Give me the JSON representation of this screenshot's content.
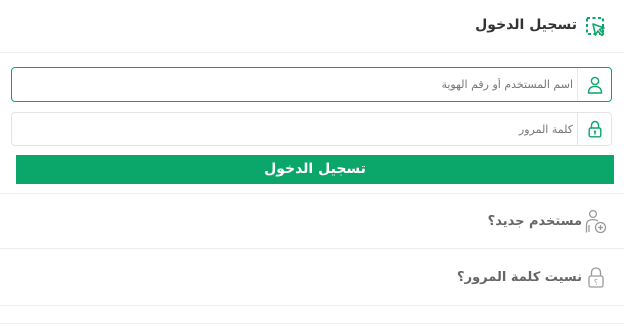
{
  "header": {
    "title": "تسجيل الدخول",
    "icon": "login-cursor-icon"
  },
  "form": {
    "username": {
      "placeholder": "اسم المستخدم أو رقم الهوية",
      "value": "",
      "icon": "user-icon"
    },
    "password": {
      "placeholder": "كلمة المرور",
      "value": "",
      "icon": "lock-icon"
    },
    "submit_label": "تسجيل الدخول"
  },
  "links": {
    "new_user": {
      "label": "مستخدم جديد؟",
      "icon": "add-user-icon"
    },
    "forgot_password": {
      "label": "نسيت كلمة المرور؟",
      "icon": "lock-question-icon"
    }
  },
  "colors": {
    "accent": "#0aa66a",
    "icon": "#9a9a9a",
    "text": "#333333",
    "muted_text": "#666666"
  }
}
